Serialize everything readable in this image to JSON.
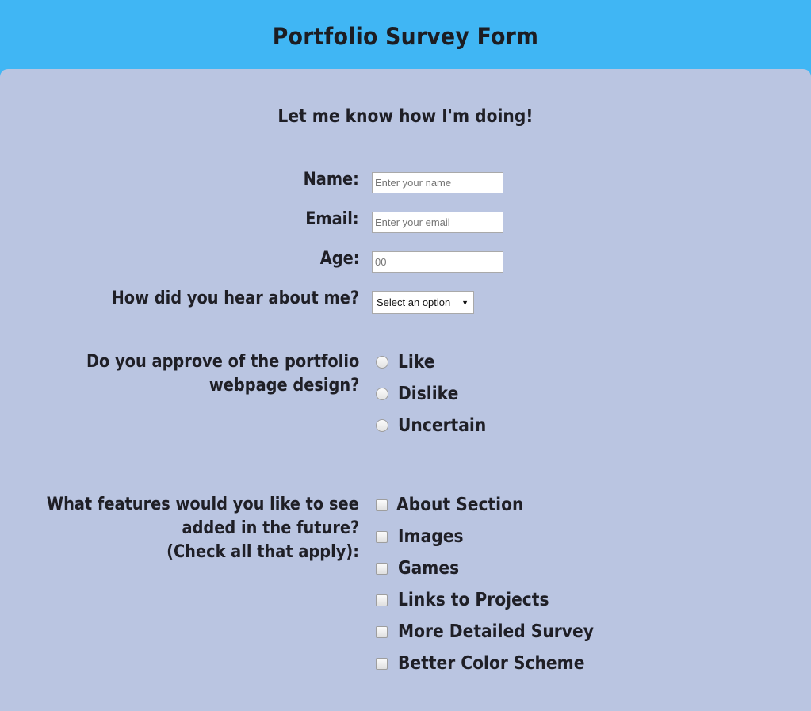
{
  "header": {
    "title": "Portfolio Survey Form"
  },
  "subtitle": "Let me know how I'm doing!",
  "fields": {
    "name": {
      "label": "Name:",
      "placeholder": "Enter your name"
    },
    "email": {
      "label": "Email:",
      "placeholder": "Enter your email"
    },
    "age": {
      "label": "Age:",
      "placeholder": "00"
    },
    "referral": {
      "label": "How did you hear about me?",
      "selected": "Select an option"
    }
  },
  "approval": {
    "label_line1": "Do you approve of the portfolio",
    "label_line2": "webpage design?",
    "options": [
      "Like",
      "Dislike",
      "Uncertain"
    ]
  },
  "features": {
    "label_line1": "What features would you like to see",
    "label_line2": "added in the future?",
    "label_line3": "(Check all that apply):",
    "options": [
      "About Section",
      "Images",
      "Games",
      "Links to Projects",
      "More Detailed Survey",
      "Better Color Scheme"
    ]
  },
  "colors": {
    "header_bg": "#40b6f4",
    "panel_bg": "#bac5e1",
    "text": "#1f1f26"
  }
}
